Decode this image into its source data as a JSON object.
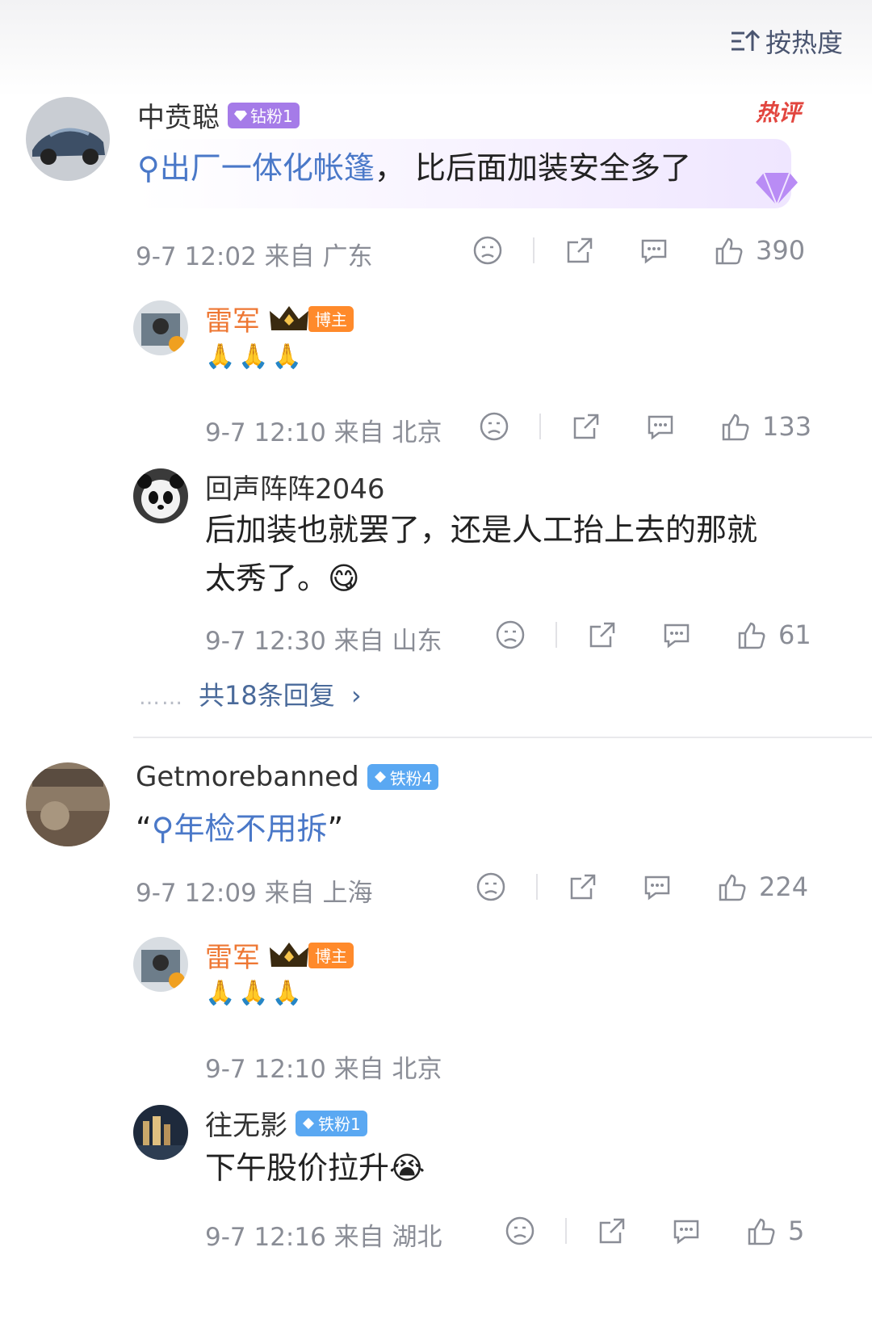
{
  "sort": {
    "label": "按热度",
    "icon": "sort-icon"
  },
  "hot_label": "热评",
  "comments": [
    {
      "user": "中贲聪",
      "badge": "钻粉1",
      "text_link": "出厂一体化帐篷",
      "text_rest": "， 比后面加装安全多了",
      "meta": "9-7 12:02 来自 广东",
      "likes": "390",
      "replies": [
        {
          "user": "雷军",
          "badge": "博主",
          "text": "🙏🙏🙏",
          "meta": "9-7 12:10 来自 北京",
          "likes": "133"
        },
        {
          "user": "回声阵阵2046",
          "text_line1": "后加装也就罢了，还是人工抬上去的那就",
          "text_line2": "太秀了。😋",
          "meta": "9-7 12:30 来自 山东",
          "likes": "61"
        }
      ],
      "more_replies": "共18条回复",
      "more_dots": "……"
    },
    {
      "user": "Getmorebanned",
      "badge": "铁粉4",
      "quote_open": "“",
      "text_link": "年检不用拆",
      "quote_close": "”",
      "meta": "9-7 12:09 来自 上海",
      "likes": "224",
      "replies": [
        {
          "user": "雷军",
          "badge": "博主",
          "text": "🙏🙏🙏",
          "meta": "9-7 12:10 来自 北京"
        },
        {
          "user": "往无影",
          "badge": "铁粉1",
          "text": "下午股价拉升😭",
          "meta": "9-7 12:16 来自 湖北",
          "likes": "5"
        }
      ]
    }
  ],
  "colors": {
    "link": "#4a78c8",
    "orange_name": "#ee7733",
    "meta": "#8a8d96"
  }
}
